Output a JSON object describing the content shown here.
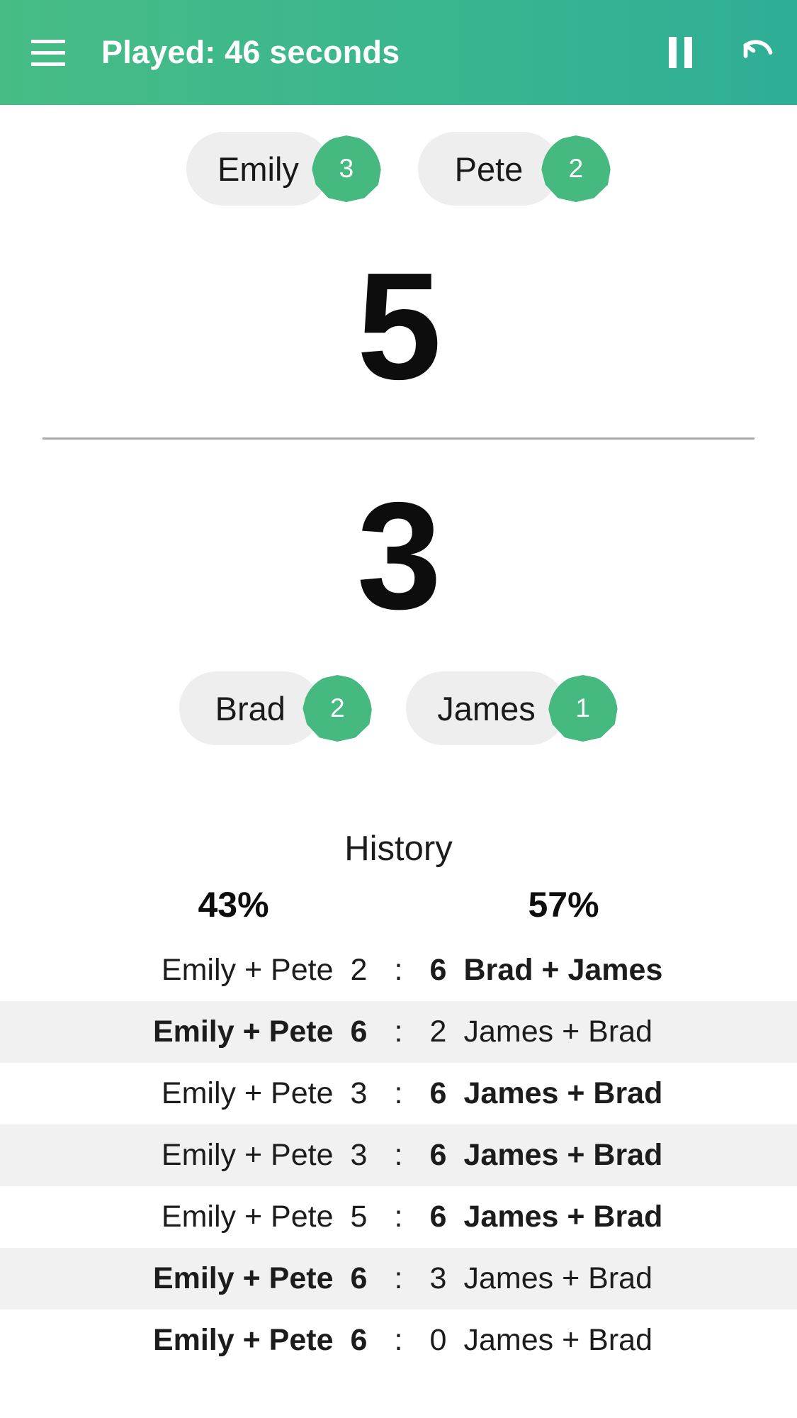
{
  "appbar": {
    "menu_icon": "hamburger-menu-icon",
    "title": "Played: 46 seconds",
    "pause_icon": "pause-icon",
    "undo_icon": "undo-icon",
    "gradient_start": "#47bc85",
    "gradient_end": "#2eae96"
  },
  "theme": {
    "accent": "#45b97f",
    "chip_bg": "#eeeeee",
    "row_alt_bg": "#f1f1f1",
    "divider": "#a9a9a9"
  },
  "match": {
    "team_top": {
      "score": "5",
      "players": [
        {
          "name": "Emily",
          "badge": "3"
        },
        {
          "name": "Pete",
          "badge": "2"
        }
      ]
    },
    "team_bottom": {
      "score": "3",
      "players": [
        {
          "name": "Brad",
          "badge": "2"
        },
        {
          "name": "James",
          "badge": "1"
        }
      ]
    }
  },
  "history": {
    "title": "History",
    "percent_left": "43%",
    "percent_right": "57%",
    "separator": ":",
    "rows": [
      {
        "team_left": "Emily + Pete",
        "score_left": "2",
        "score_right": "6",
        "team_right": "Brad + James",
        "winner": "right"
      },
      {
        "team_left": "Emily + Pete",
        "score_left": "6",
        "score_right": "2",
        "team_right": "James + Brad",
        "winner": "left"
      },
      {
        "team_left": "Emily + Pete",
        "score_left": "3",
        "score_right": "6",
        "team_right": "James + Brad",
        "winner": "right"
      },
      {
        "team_left": "Emily + Pete",
        "score_left": "3",
        "score_right": "6",
        "team_right": "James + Brad",
        "winner": "right"
      },
      {
        "team_left": "Emily + Pete",
        "score_left": "5",
        "score_right": "6",
        "team_right": "James + Brad",
        "winner": "right"
      },
      {
        "team_left": "Emily + Pete",
        "score_left": "6",
        "score_right": "3",
        "team_right": "James + Brad",
        "winner": "left"
      },
      {
        "team_left": "Emily + Pete",
        "score_left": "6",
        "score_right": "0",
        "team_right": "James + Brad",
        "winner": "left"
      }
    ]
  }
}
